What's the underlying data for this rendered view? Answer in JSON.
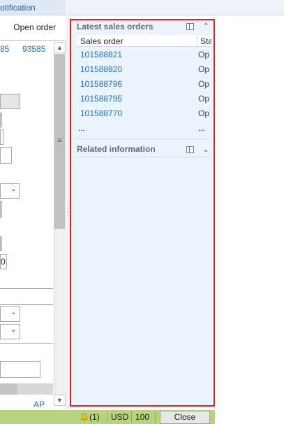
{
  "window": {
    "notification_tab": "otification"
  },
  "left_form": {
    "open_order_label": "Open order",
    "tab_a": "85",
    "tab_b": "93585",
    "field_value_0": "0",
    "footer_link": "AP"
  },
  "factbox": {
    "latest_sales_orders": {
      "title": "Latest sales orders",
      "columns": [
        "Sales order",
        "Sta"
      ],
      "rows": [
        {
          "order": "101588821",
          "status": "Op"
        },
        {
          "order": "101588820",
          "status": "Op"
        },
        {
          "order": "101588796",
          "status": "Op"
        },
        {
          "order": "101588795",
          "status": "Op"
        },
        {
          "order": "101588770",
          "status": "Op"
        }
      ],
      "more_order": "...",
      "more_status": "...",
      "collapse_icon": "chevron-up-icon",
      "options_icon": "factbox-options-icon"
    },
    "related_information": {
      "title": "Related information",
      "expand_icon": "chevron-down-icon",
      "options_icon": "factbox-options-icon"
    }
  },
  "statusbar": {
    "notification_count": "(1)",
    "currency": "USD",
    "company": "100",
    "close_label": "Close"
  },
  "colors": {
    "highlight_border": "#e12026",
    "factbox_background": "#eaf4fd",
    "link": "#1f6fc3",
    "statusbar": "#b7d37c"
  }
}
